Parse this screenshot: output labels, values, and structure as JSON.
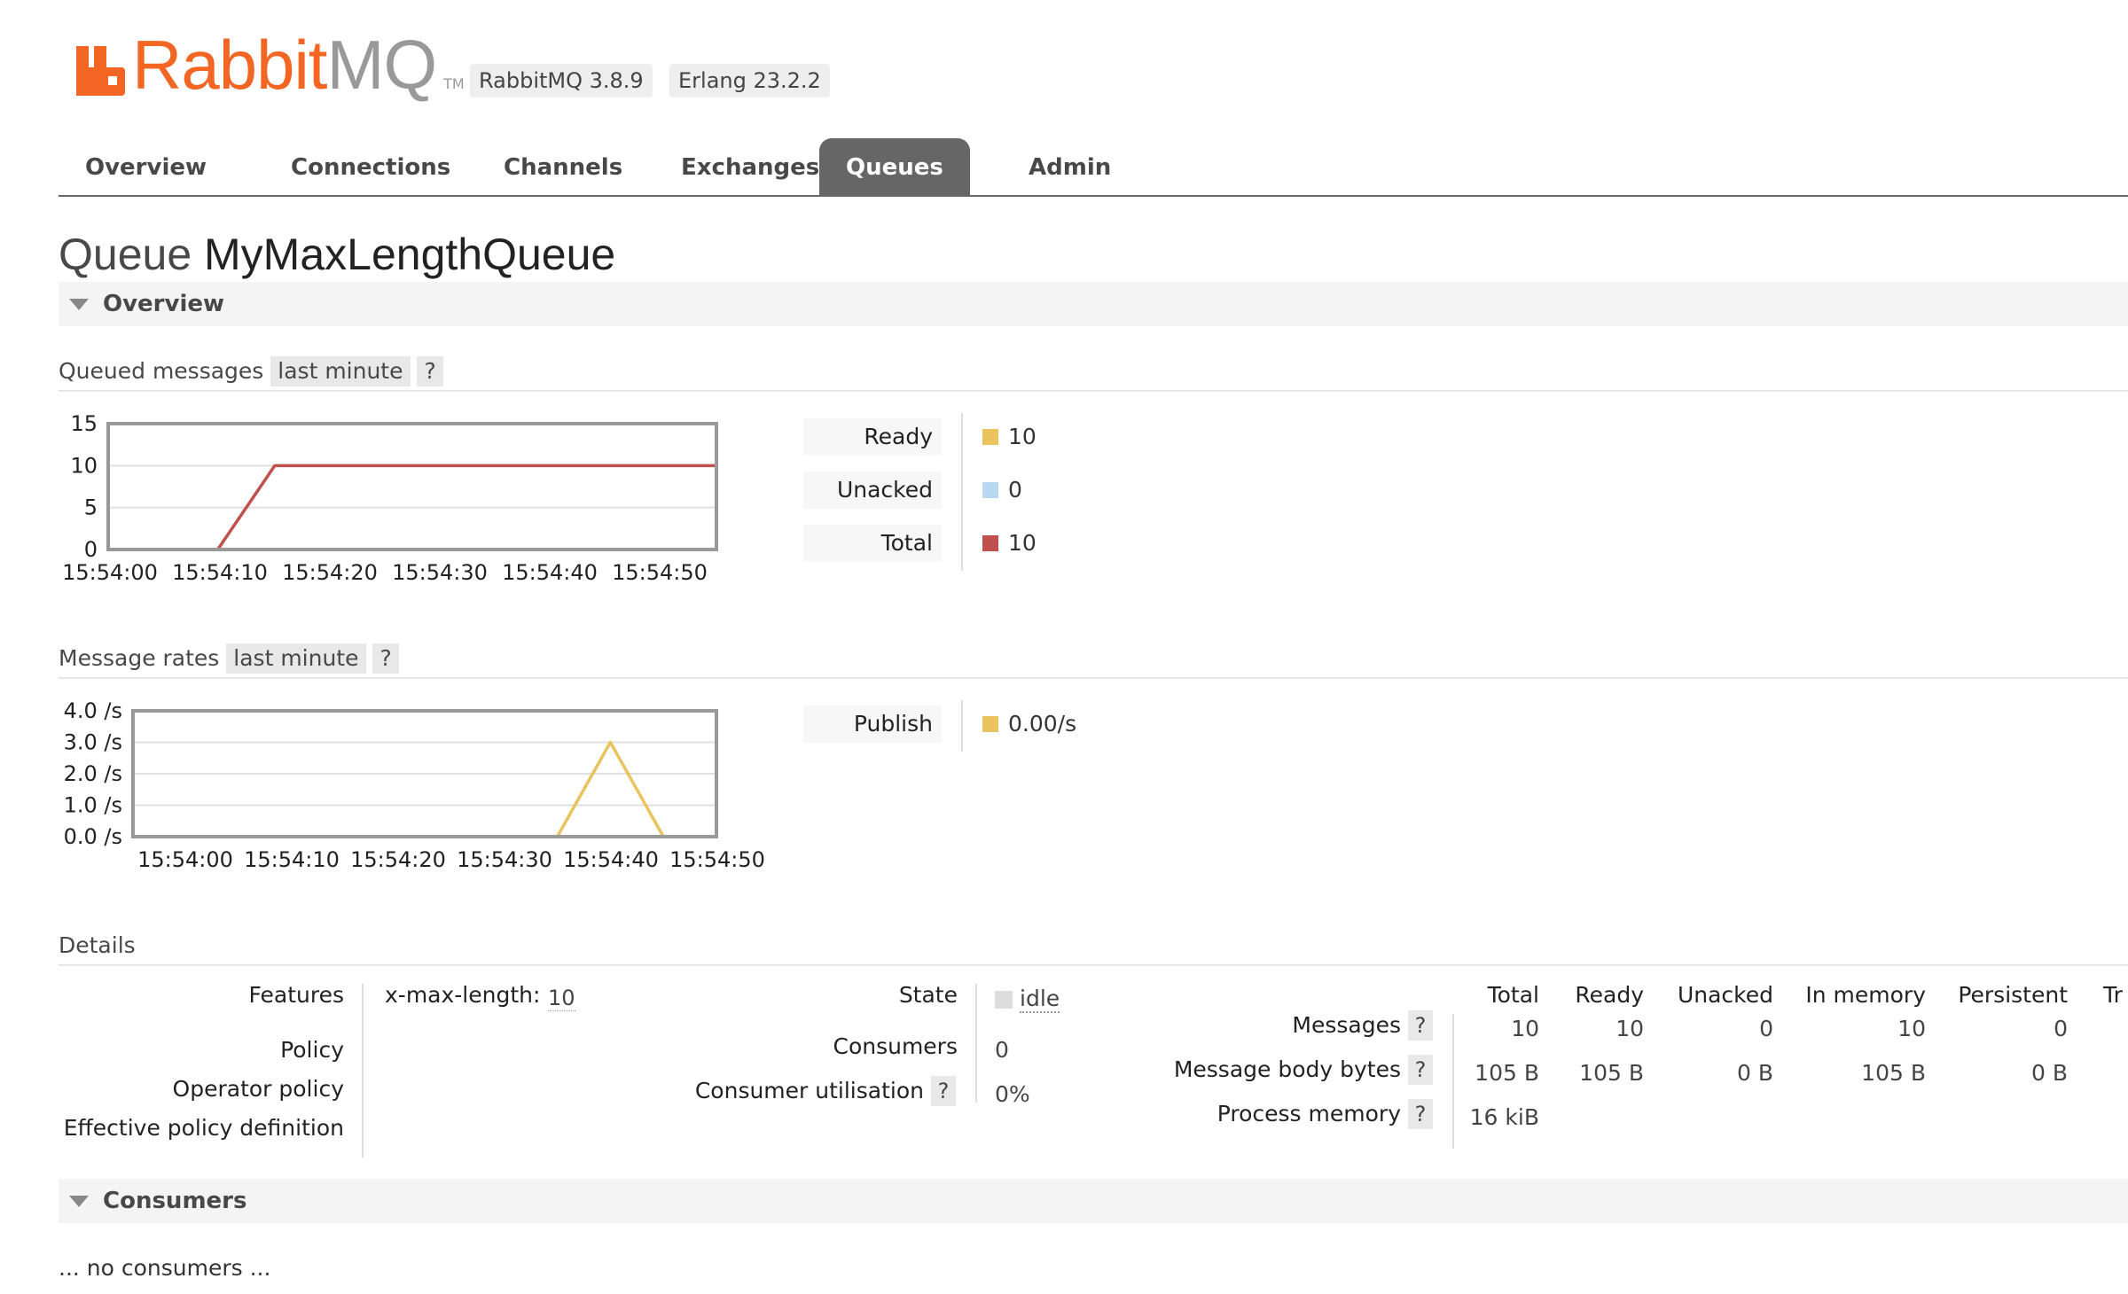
{
  "header": {
    "logo_word_a": "Rabbit",
    "logo_word_b": "MQ",
    "logo_tm": "TM",
    "version": "RabbitMQ 3.8.9",
    "erlang": "Erlang 23.2.2"
  },
  "nav": {
    "tabs": [
      "Overview",
      "Connections",
      "Channels",
      "Exchanges",
      "Queues",
      "Admin"
    ],
    "active": "Queues"
  },
  "page": {
    "title_prefix": "Queue",
    "queue_name": "MyMaxLengthQueue"
  },
  "overview_section": {
    "label": "Overview"
  },
  "queued_messages": {
    "label": "Queued messages",
    "range": "last minute",
    "help": "?",
    "legend": [
      {
        "label": "Ready",
        "value": "10",
        "color": "#e8c35e"
      },
      {
        "label": "Unacked",
        "value": "0",
        "color": "#b8d7f0"
      },
      {
        "label": "Total",
        "value": "10",
        "color": "#c0504d"
      }
    ]
  },
  "message_rates": {
    "label": "Message rates",
    "range": "last minute",
    "help": "?",
    "legend": [
      {
        "label": "Publish",
        "value": "0.00/s",
        "color": "#e8c35e"
      }
    ]
  },
  "chart_data": [
    {
      "type": "line",
      "title": "",
      "x": [
        "15:54:00",
        "15:54:10",
        "15:54:20",
        "15:54:30",
        "15:54:40",
        "15:54:50",
        "15:54:55"
      ],
      "x_ticks": [
        "15:54:00",
        "15:54:10",
        "15:54:20",
        "15:54:30",
        "15:54:40",
        "15:54:50"
      ],
      "y_ticks": [
        "15",
        "10",
        "5",
        "0"
      ],
      "ylim": [
        0,
        15
      ],
      "series": [
        {
          "name": "Total",
          "color": "#c0504d",
          "x": [
            0,
            10,
            15.2,
            55.5
          ],
          "values": [
            0,
            0,
            10,
            10
          ]
        },
        {
          "name": "Unacked",
          "color": "#b8d7f0",
          "x": [
            0,
            55.5
          ],
          "values": [
            0,
            0
          ]
        },
        {
          "name": "Ready",
          "color": "#e8c35e",
          "x": [
            0,
            55.5
          ],
          "values": [
            0,
            0
          ]
        }
      ]
    },
    {
      "type": "line",
      "title": "",
      "x_ticks": [
        "15:54:00",
        "15:54:10",
        "15:54:20",
        "15:54:30",
        "15:54:40",
        "15:54:50"
      ],
      "y_ticks": [
        "4.0 /s",
        "3.0 /s",
        "2.0 /s",
        "1.0 /s",
        "0.0 /s"
      ],
      "ylim": [
        0,
        4
      ],
      "series": [
        {
          "name": "Publish",
          "color": "#e8c35e",
          "x": [
            0,
            40,
            45,
            50,
            55
          ],
          "values": [
            0,
            0,
            3,
            0,
            0
          ]
        }
      ]
    }
  ],
  "details": {
    "label": "Details",
    "features_label": "Features",
    "features_key": "x-max-length:",
    "features_value": "10",
    "policy_label": "Policy",
    "operator_policy_label": "Operator policy",
    "effective_policy_label": "Effective policy definition",
    "state_label": "State",
    "state_value": "idle",
    "consumers_label": "Consumers",
    "consumers_value": "0",
    "consumer_util_label": "Consumer utilisation",
    "consumer_util_value": "0%",
    "help": "?",
    "table": {
      "columns": [
        "Total",
        "Ready",
        "Unacked",
        "In memory",
        "Persistent",
        "Tr"
      ],
      "rows": [
        {
          "label": "Messages",
          "values": [
            "10",
            "10",
            "0",
            "10",
            "0"
          ]
        },
        {
          "label": "Message body bytes",
          "values": [
            "105 B",
            "105 B",
            "0 B",
            "105 B",
            "0 B"
          ]
        },
        {
          "label": "Process memory",
          "values": [
            "16 kiB"
          ]
        }
      ]
    }
  },
  "consumers_section": {
    "label": "Consumers",
    "empty_text": "... no consumers ..."
  }
}
